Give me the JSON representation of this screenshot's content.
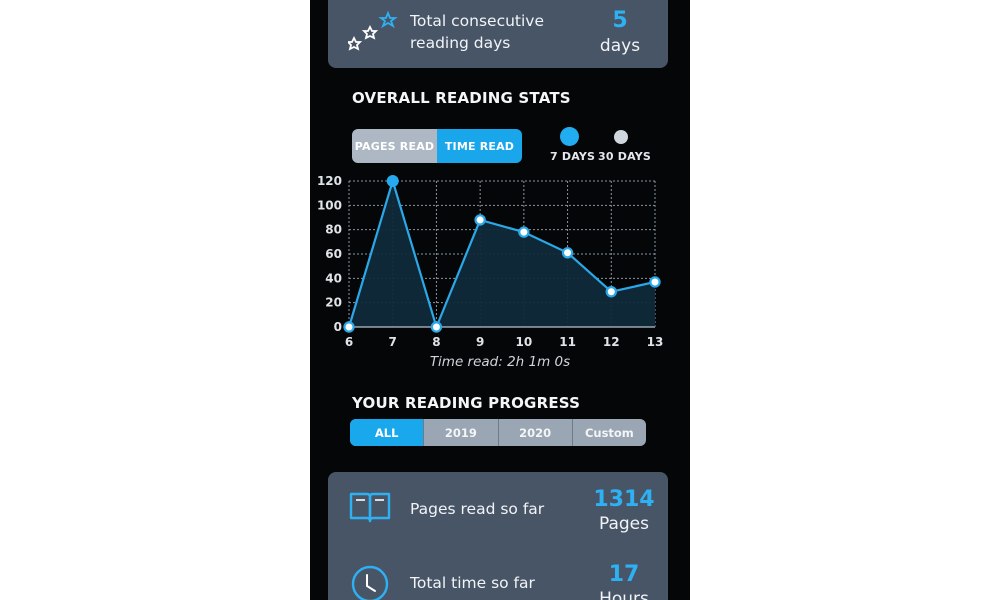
{
  "streak": {
    "label_line1": "Total consecutive",
    "label_line2": "reading days",
    "value": "5",
    "unit": "days"
  },
  "stats": {
    "title": "OVERALL READING STATS",
    "toggle": {
      "pages_label": "PAGES READ",
      "time_label": "TIME READ",
      "active": "time"
    },
    "ranges": [
      {
        "label": "7 DAYS",
        "active": true
      },
      {
        "label": "30 DAYS",
        "active": false
      }
    ],
    "time_read": "Time read: 2h 1m 0s"
  },
  "chart_data": {
    "type": "area",
    "x": [
      6,
      7,
      8,
      9,
      10,
      11,
      12,
      13
    ],
    "values": [
      0,
      120,
      0,
      88,
      78,
      61,
      29,
      37
    ],
    "y_ticks": [
      0,
      20,
      40,
      60,
      80,
      100,
      120
    ],
    "ylim": [
      0,
      120
    ],
    "grid": true,
    "highlight_index": 1,
    "colors": {
      "line": "#2ba8e8",
      "fill": "#0f2a3b",
      "grid": "#8896a6",
      "axis_text": "#dfe4e9"
    }
  },
  "progress": {
    "title": "YOUR READING PROGRESS",
    "tabs": [
      {
        "label": "ALL",
        "active": true
      },
      {
        "label": "2019",
        "active": false
      },
      {
        "label": "2020",
        "active": false
      },
      {
        "label": "Custom",
        "active": false
      }
    ]
  },
  "summary": {
    "pages": {
      "label": "Pages read so far",
      "value": "1314",
      "unit": "Pages",
      "icon": "book-icon"
    },
    "time": {
      "label": "Total time so far",
      "value": "17",
      "unit": "Hours",
      "icon": "clock-icon"
    }
  },
  "colors": {
    "accent": "#1aa8ec",
    "card": "#485566",
    "background": "#050607"
  }
}
